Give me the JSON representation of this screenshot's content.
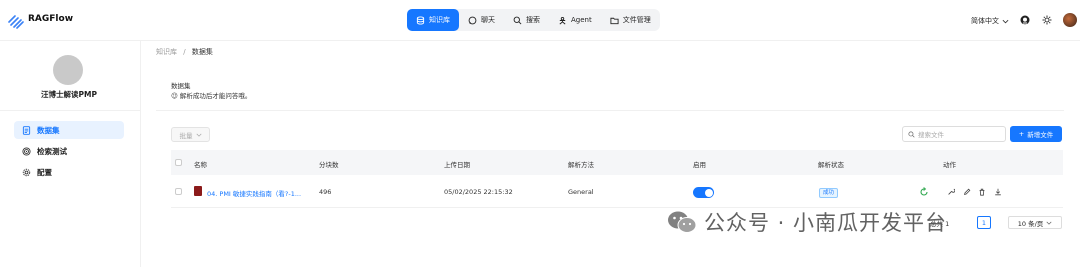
{
  "app": {
    "title": "RAGFlow"
  },
  "nav": [
    {
      "label": "知识库",
      "icon": "database-icon",
      "active": true
    },
    {
      "label": "聊天",
      "icon": "chat-icon",
      "active": false
    },
    {
      "label": "搜索",
      "icon": "search-icon",
      "active": false
    },
    {
      "label": "Agent",
      "icon": "agent-icon",
      "active": false
    },
    {
      "label": "文件管理",
      "icon": "folder-icon",
      "active": false
    }
  ],
  "header": {
    "language": "简体中文"
  },
  "sidebar": {
    "kb_name": "汪博士解读PMP",
    "items": [
      {
        "label": "数据集",
        "icon": "file-list-icon",
        "active": true
      },
      {
        "label": "检索测试",
        "icon": "target-icon",
        "active": false
      },
      {
        "label": "配置",
        "icon": "gear-icon",
        "active": false
      }
    ]
  },
  "breadcrumb": {
    "root": "知识库",
    "separator": "/",
    "current": "数据集"
  },
  "dataset": {
    "title": "数据集",
    "desc": "😉 解析成功后才能问答哦。"
  },
  "toolbar": {
    "batch_label": "批量",
    "search_placeholder": "搜索文件",
    "add_label": "新增文件"
  },
  "table": {
    "headers": [
      "名称",
      "分块数",
      "上传日期",
      "解析方法",
      "启用",
      "解析状态",
      "动作"
    ],
    "rows": [
      {
        "name": "04. PMI 敏捷实践指南（看?-1...",
        "chunks": "496",
        "date": "05/02/2025 22:15:32",
        "method": "General",
        "enabled": true,
        "status": "成功"
      }
    ]
  },
  "pagination": {
    "total": "总共 1",
    "current": "1",
    "page_size": "10 条/页"
  },
  "watermark": {
    "text": "公众号 · 小南瓜开发平台"
  },
  "colors": {
    "accent": "#1677ff"
  }
}
